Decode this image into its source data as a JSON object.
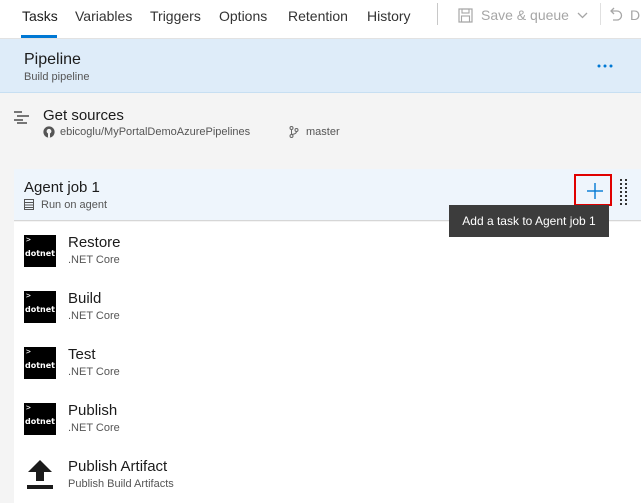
{
  "tabs": [
    {
      "label": "Tasks",
      "active": true
    },
    {
      "label": "Variables"
    },
    {
      "label": "Triggers"
    },
    {
      "label": "Options"
    },
    {
      "label": "Retention"
    },
    {
      "label": "History"
    }
  ],
  "toolbar": {
    "save_label": "Save & queue",
    "undo_label": "D"
  },
  "pipeline": {
    "title": "Pipeline",
    "subtitle": "Build pipeline"
  },
  "get_sources": {
    "title": "Get sources",
    "repo": "ebicoglu/MyPortalDemoAzurePipelines",
    "branch": "master"
  },
  "agent_job": {
    "title": "Agent job 1",
    "subtitle": "Run on agent",
    "add_tooltip": "Add a task to Agent job 1"
  },
  "tasks": [
    {
      "title": "Restore",
      "subtitle": ".NET Core",
      "icon": "dotnet"
    },
    {
      "title": "Build",
      "subtitle": ".NET Core",
      "icon": "dotnet"
    },
    {
      "title": "Test",
      "subtitle": ".NET Core",
      "icon": "dotnet"
    },
    {
      "title": "Publish",
      "subtitle": ".NET Core",
      "icon": "dotnet"
    },
    {
      "title": "Publish Artifact",
      "subtitle": "Publish Build Artifacts",
      "icon": "upload-arrow"
    }
  ],
  "dotnet_icon_text": "dotnet",
  "colors": {
    "accent": "#0078d4",
    "selected_row": "#deecf9",
    "highlight_box": "#e00000",
    "tooltip_bg": "#3c3c3c"
  }
}
